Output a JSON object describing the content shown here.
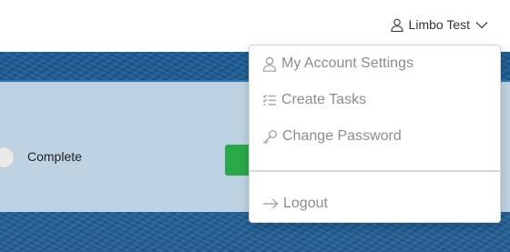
{
  "header": {
    "user_name": "Limbo Test",
    "user_icon": "user-icon",
    "chevron_icon": "chevron-down-icon"
  },
  "task_row": {
    "complete_label": "Complete",
    "action_button_color": "#2aa84a"
  },
  "dropdown": {
    "items": [
      {
        "label": "My Account Settings",
        "icon": "user-icon"
      },
      {
        "label": "Create Tasks",
        "icon": "list-check-icon"
      },
      {
        "label": "Change Password",
        "icon": "key-icon"
      },
      {
        "label": "Logout",
        "icon": "arrow-right-icon"
      }
    ]
  },
  "colors": {
    "background_blue": "#1f5f98",
    "panel": "#bdd2e2",
    "panel_border": "#2c77b3",
    "menu_text": "#8c8c8c"
  }
}
